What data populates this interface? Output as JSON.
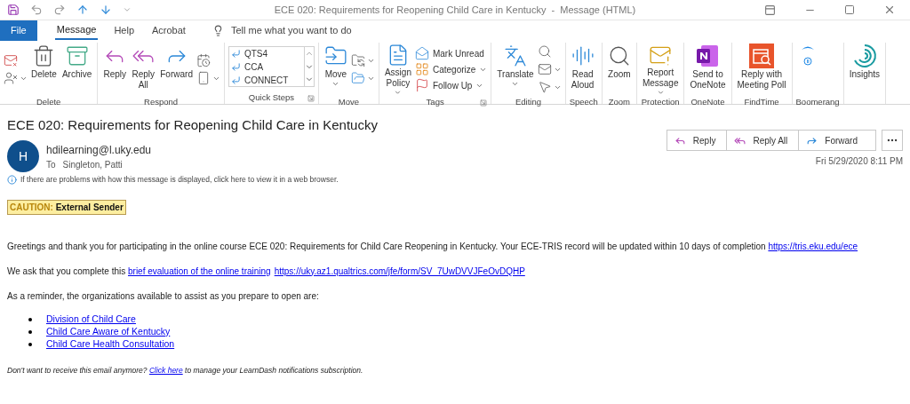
{
  "window": {
    "title": "ECE 020: Requirements for Reopening Child Care in Kentucky  -  Message (HTML)"
  },
  "tabs": [
    {
      "label": "File",
      "kind": "file",
      "selected": false
    },
    {
      "label": "Message",
      "kind": "tab",
      "selected": true
    },
    {
      "label": "Help",
      "kind": "tab",
      "selected": false
    },
    {
      "label": "Acrobat",
      "kind": "tab",
      "selected": false
    }
  ],
  "tell_me": {
    "placeholder": "Tell me what you want to do"
  },
  "ribbon": {
    "groups": [
      {
        "label": "Delete",
        "columns": [
          [
            {
              "kind": "icon"
            },
            {
              "kind": "icon",
              "dropdown": true
            }
          ],
          [
            {
              "kind": "large",
              "label": "Delete"
            }
          ],
          [
            {
              "kind": "large",
              "label": "Archive"
            }
          ]
        ]
      },
      {
        "label": "Respond",
        "columns": [
          [
            {
              "kind": "large",
              "label": "Reply"
            }
          ],
          [
            {
              "kind": "large",
              "label": "Reply\nAll"
            }
          ],
          [
            {
              "kind": "large",
              "label": "Forward"
            }
          ],
          [
            {
              "kind": "icon"
            },
            {
              "kind": "icon",
              "dropdown": true
            }
          ]
        ]
      },
      {
        "label": "Quick Steps",
        "launcher": true,
        "columns": [
          [
            {
              "kind": "quicksteps",
              "steps": [
                "QTS4",
                "CCA",
                "CONNECT"
              ]
            }
          ]
        ]
      },
      {
        "label": "Move",
        "columns": [
          [
            {
              "kind": "large",
              "label": "Move",
              "dropdown": true
            }
          ],
          [
            {
              "kind": "icon",
              "dropdown": true
            },
            {
              "kind": "icon",
              "dropdown": true
            }
          ]
        ]
      },
      {
        "label": "Tags",
        "launcher": true,
        "columns": [
          [
            {
              "kind": "large",
              "label": "Assign\nPolicy",
              "dropdown": true
            }
          ],
          [
            {
              "kind": "small",
              "label": "Mark Unread"
            },
            {
              "kind": "small",
              "label": "Categorize",
              "dropdown": true
            },
            {
              "kind": "small",
              "label": "Follow Up",
              "dropdown": true
            }
          ]
        ]
      },
      {
        "label": "Editing",
        "columns": [
          [
            {
              "kind": "large",
              "label": "Translate",
              "dropdown": true
            }
          ],
          [
            {
              "kind": "icon"
            },
            {
              "kind": "icon",
              "dropdown": true
            },
            {
              "kind": "icon",
              "dropdown": true
            }
          ]
        ]
      },
      {
        "label": "Speech",
        "columns": [
          [
            {
              "kind": "large",
              "label": "Read\nAloud"
            }
          ]
        ]
      },
      {
        "label": "Zoom",
        "columns": [
          [
            {
              "kind": "large",
              "label": "Zoom"
            }
          ]
        ]
      },
      {
        "label": "Protection",
        "columns": [
          [
            {
              "kind": "large",
              "label": "Report\nMessage",
              "dropdown": true
            }
          ]
        ]
      },
      {
        "label": "OneNote",
        "columns": [
          [
            {
              "kind": "large",
              "label": "Send to\nOneNote"
            }
          ]
        ]
      },
      {
        "label": "FindTime",
        "columns": [
          [
            {
              "kind": "large",
              "label": "Reply with\nMeeting Poll"
            }
          ]
        ]
      },
      {
        "label": "Boomerang",
        "columns": [
          [
            {
              "kind": "large"
            }
          ]
        ]
      },
      {
        "columns": [
          [
            {
              "kind": "large",
              "label": "Insights"
            }
          ]
        ]
      }
    ]
  },
  "message": {
    "subject": "ECE 020: Requirements for Reopening Child Care in Kentucky",
    "sender": {
      "initial": "H",
      "email": "hdilearning@l.uky.edu",
      "to_label": "To",
      "to": "Singleton, Patti"
    },
    "actions": [
      {
        "label": "Reply"
      },
      {
        "label": "Reply All"
      },
      {
        "label": "Forward"
      }
    ],
    "date": "Fri 5/29/2020 8:11 PM",
    "info": "If there are problems with how this message is displayed, click here to view it in a web browser."
  },
  "caution": {
    "prefix": "CAUTION:",
    "text": "External Sender"
  },
  "body": {
    "paragraphs": [
      [
        {
          "text": "Greetings and thank you for participating in the online course ECE 020: Requirements for Child Care Reopening in Kentucky. Your ECE-TRIS record will be updated within 10 days of completion ",
          "link": false
        },
        {
          "text": "https://tris.eku.edu/ece",
          "link": true
        }
      ],
      [
        {
          "text": "We ask that you complete this ",
          "link": false
        },
        {
          "text": "brief evaluation of the online training",
          "link": true
        },
        {
          "text": "https://uky.az1.qualtrics.com/jfe/form/SV_7UwDVVJFeOvDQHP",
          "link": true
        }
      ],
      [
        {
          "text": "As a reminder, the organizations available to assist as you prepare to open are:",
          "link": false
        }
      ]
    ],
    "list": [
      "Division of Child Care",
      "Child Care Aware of Kentucky",
      "Child Care Health Consultation"
    ],
    "footer": [
      {
        "text": "Don't want to receive this email anymore? ",
        "link": false
      },
      {
        "text": "Click here",
        "link": true
      },
      {
        "text": " to manage your LearnDash notifications subscription.",
        "link": false
      }
    ]
  }
}
